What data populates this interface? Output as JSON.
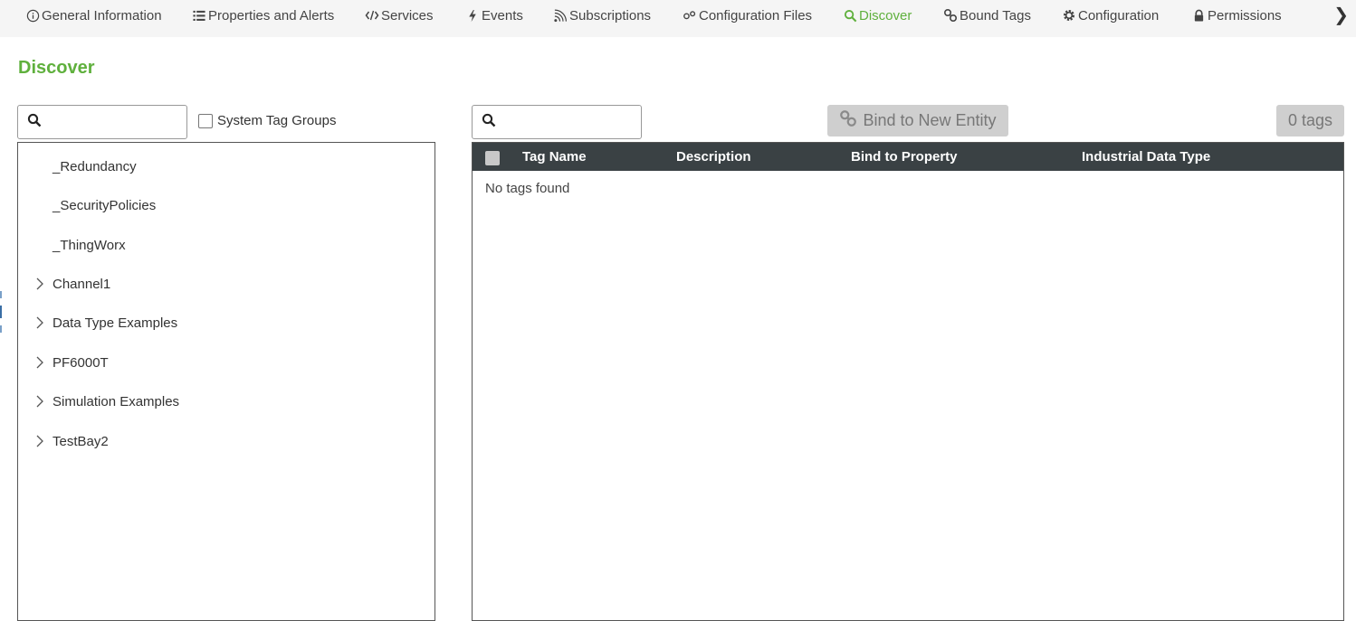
{
  "tabs": [
    {
      "label": "General Information",
      "icon": "info-icon",
      "active": false
    },
    {
      "label": "Properties and Alerts",
      "icon": "list-icon",
      "active": false
    },
    {
      "label": "Services",
      "icon": "code-icon",
      "active": false
    },
    {
      "label": "Events",
      "icon": "bolt-icon",
      "active": false
    },
    {
      "label": "Subscriptions",
      "icon": "rss-icon",
      "active": false
    },
    {
      "label": "Configuration Files",
      "icon": "gears-icon",
      "active": false
    },
    {
      "label": "Discover",
      "icon": "search-icon",
      "active": true
    },
    {
      "label": "Bound Tags",
      "icon": "link-icon",
      "active": false
    },
    {
      "label": "Configuration",
      "icon": "gear-icon",
      "active": false
    },
    {
      "label": "Permissions",
      "icon": "lock-icon",
      "active": false
    }
  ],
  "more_tabs_glyph": "❯",
  "page_title": "Discover",
  "left": {
    "search_placeholder": "",
    "system_tag_groups_label": "System Tag Groups",
    "system_tag_groups_checked": false,
    "tree_items": [
      {
        "label": "_Redundancy",
        "expandable": false
      },
      {
        "label": "_SecurityPolicies",
        "expandable": false
      },
      {
        "label": "_ThingWorx",
        "expandable": false
      },
      {
        "label": "Channel1",
        "expandable": true
      },
      {
        "label": "Data Type Examples",
        "expandable": true
      },
      {
        "label": "PF6000T",
        "expandable": true
      },
      {
        "label": "Simulation Examples",
        "expandable": true
      },
      {
        "label": "TestBay2",
        "expandable": true
      }
    ]
  },
  "right": {
    "search_placeholder": "",
    "bind_button_label": "Bind to New Entity",
    "tag_count_label": "0 tags",
    "columns": [
      "Tag Name",
      "Description",
      "Bind to Property",
      "Industrial Data Type"
    ],
    "empty_message": "No tags found"
  },
  "colors": {
    "accent": "#5fb03d",
    "header_bg": "#3a4144",
    "disabled_button": "#cfcfcf"
  }
}
